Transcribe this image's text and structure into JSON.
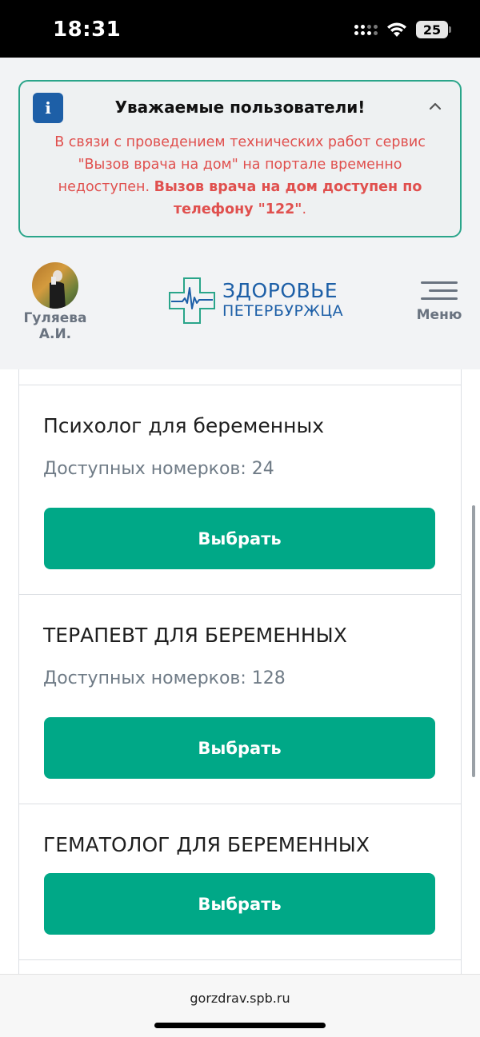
{
  "status_bar": {
    "time": "18:31",
    "battery": "25",
    "icons": [
      "signal-icon",
      "wifi-icon",
      "battery-icon"
    ]
  },
  "notice": {
    "info_icon_text": "i",
    "title": "Уважаемые пользователи!",
    "text_regular": "В связи с проведением технических работ сервис \"Вызов врача на дом\" на портале временно недоступен. ",
    "text_bold": "Вызов врача на дом доступен по телефону \"122\"",
    "text_end": ".",
    "text_color": "#e0504e",
    "border_color": "#2aa58a"
  },
  "header": {
    "user_name": "Гуляева А.И.",
    "logo_line1": "ЗДОРОВЬЕ",
    "logo_line2": "ПЕТЕРБУРЖЦА",
    "menu_label": "Меню",
    "brand_color": "#1d5fa7"
  },
  "cards": [
    {
      "title": "Психолог для беременных",
      "subtitle": "Доступных номерков: 24",
      "button": "Выбрать"
    },
    {
      "title": "ТЕРАПЕВТ ДЛЯ БЕРЕМЕННЫХ",
      "subtitle": "Доступных номерков: 128",
      "button": "Выбрать"
    },
    {
      "title": "ГЕМАТОЛОГ ДЛЯ БЕРЕМЕННЫХ",
      "button": "Выбрать"
    }
  ],
  "accent_color": "#00a887",
  "url_bar": {
    "url": "gorzdrav.spb.ru"
  }
}
